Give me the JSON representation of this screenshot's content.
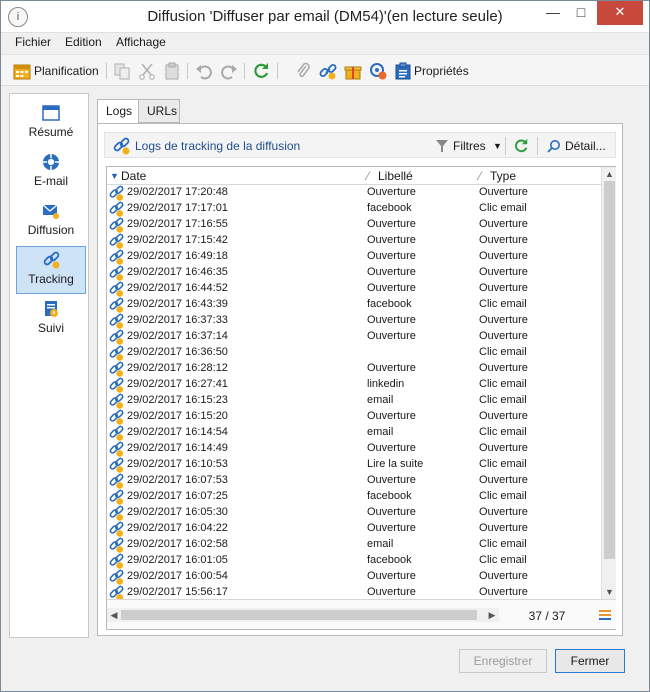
{
  "window": {
    "title": "Diffusion 'Diffuser par email (DM54)'(en lecture seule)",
    "app_icon": "i"
  },
  "menu": [
    "Fichier",
    "Edition",
    "Affichage"
  ],
  "toolbar": {
    "planification": "Planification",
    "proprietes": "Propriétés"
  },
  "nav": [
    {
      "label": "Résumé",
      "icon": "summary-icon"
    },
    {
      "label": "E-mail",
      "icon": "email-icon"
    },
    {
      "label": "Diffusion",
      "icon": "delivery-icon"
    },
    {
      "label": "Tracking",
      "icon": "tracking-icon",
      "selected": true
    },
    {
      "label": "Suivi",
      "icon": "audit-icon"
    }
  ],
  "tabs": [
    {
      "label": "Logs",
      "active": true
    },
    {
      "label": "URLs",
      "active": false
    }
  ],
  "subbar": {
    "title": "Logs de tracking de la diffusion",
    "filters": "Filtres",
    "detail": "Détail..."
  },
  "grid": {
    "columns": [
      "Date",
      "Libellé",
      "Type"
    ],
    "rows": [
      {
        "date": "29/02/2017 17:20:48",
        "label": "Ouverture",
        "type": "Ouverture"
      },
      {
        "date": "29/02/2017 17:17:01",
        "label": "facebook",
        "type": "Clic email"
      },
      {
        "date": "29/02/2017 17:16:55",
        "label": "Ouverture",
        "type": "Ouverture"
      },
      {
        "date": "29/02/2017 17:15:42",
        "label": "Ouverture",
        "type": "Ouverture"
      },
      {
        "date": "29/02/2017 16:49:18",
        "label": "Ouverture",
        "type": "Ouverture"
      },
      {
        "date": "29/02/2017 16:46:35",
        "label": "Ouverture",
        "type": "Ouverture"
      },
      {
        "date": "29/02/2017 16:44:52",
        "label": "Ouverture",
        "type": "Ouverture"
      },
      {
        "date": "29/02/2017 16:43:39",
        "label": "facebook",
        "type": "Clic email"
      },
      {
        "date": "29/02/2017 16:37:33",
        "label": "Ouverture",
        "type": "Ouverture"
      },
      {
        "date": "29/02/2017 16:37:14",
        "label": "Ouverture",
        "type": "Ouverture"
      },
      {
        "date": "29/02/2017 16:36:50",
        "label": "",
        "type": "Clic email"
      },
      {
        "date": "29/02/2017 16:28:12",
        "label": "Ouverture",
        "type": "Ouverture"
      },
      {
        "date": "29/02/2017 16:27:41",
        "label": "linkedin",
        "type": "Clic email"
      },
      {
        "date": "29/02/2017 16:15:23",
        "label": "email",
        "type": "Clic email"
      },
      {
        "date": "29/02/2017 16:15:20",
        "label": "Ouverture",
        "type": "Ouverture"
      },
      {
        "date": "29/02/2017 16:14:54",
        "label": "email",
        "type": "Clic email"
      },
      {
        "date": "29/02/2017 16:14:49",
        "label": "Ouverture",
        "type": "Ouverture"
      },
      {
        "date": "29/02/2017 16:10:53",
        "label": "Lire la suite",
        "type": "Clic email"
      },
      {
        "date": "29/02/2017 16:07:53",
        "label": "Ouverture",
        "type": "Ouverture"
      },
      {
        "date": "29/02/2017 16:07:25",
        "label": "facebook",
        "type": "Clic email"
      },
      {
        "date": "29/02/2017 16:05:30",
        "label": "Ouverture",
        "type": "Ouverture"
      },
      {
        "date": "29/02/2017 16:04:22",
        "label": "Ouverture",
        "type": "Ouverture"
      },
      {
        "date": "29/02/2017 16:02:58",
        "label": "email",
        "type": "Clic email"
      },
      {
        "date": "29/02/2017 16:01:05",
        "label": "facebook",
        "type": "Clic email"
      },
      {
        "date": "29/02/2017 16:00:54",
        "label": "Ouverture",
        "type": "Ouverture"
      },
      {
        "date": "29/02/2017 15:56:17",
        "label": "Ouverture",
        "type": "Ouverture"
      }
    ],
    "counter": "37 / 37"
  },
  "buttons": {
    "save": "Enregistrer",
    "close": "Fermer"
  },
  "colors": {
    "accent": "#1f4e8c",
    "selected_bg": "#cfe3f7",
    "refresh_green": "#2e9c3a"
  }
}
